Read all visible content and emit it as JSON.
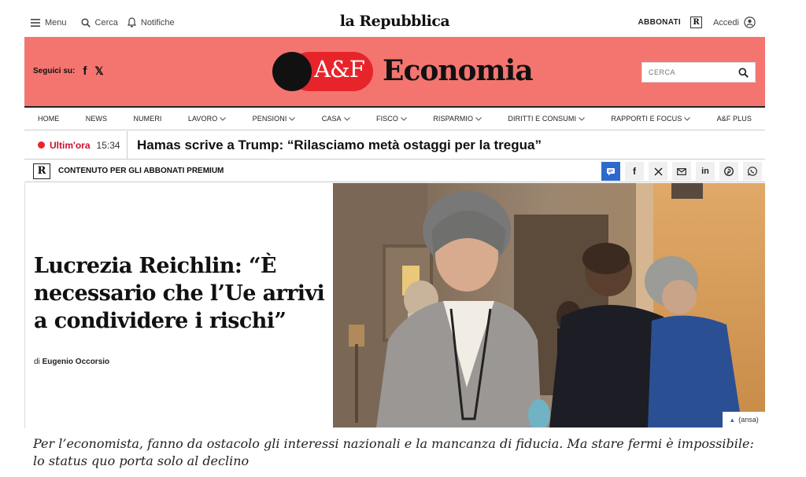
{
  "topbar": {
    "menu_label": "Menu",
    "search_label": "Cerca",
    "notifications_label": "Notifiche",
    "logo": "la Repubblica",
    "subscribe_label": "ABBONATI",
    "r_badge": "R",
    "login_label": "Accedi"
  },
  "section_header": {
    "follow_label": "Seguici su:",
    "facebook_glyph": "f",
    "x_glyph": "𝕏",
    "af_logo_text": "A&F",
    "section_title": "Economia",
    "search_placeholder": "CERCA",
    "brand_color": "#f4756f",
    "accent_color": "#e8242b"
  },
  "nav": {
    "items": [
      {
        "label": "HOME",
        "dropdown": false
      },
      {
        "label": "NEWS",
        "dropdown": false
      },
      {
        "label": "NUMERI",
        "dropdown": false
      },
      {
        "label": "LAVORO",
        "dropdown": true
      },
      {
        "label": "PENSIONI",
        "dropdown": true
      },
      {
        "label": "CASA",
        "dropdown": true
      },
      {
        "label": "FISCO",
        "dropdown": true
      },
      {
        "label": "RISPARMIO",
        "dropdown": true
      },
      {
        "label": "DIRITTI E CONSUMI",
        "dropdown": true
      },
      {
        "label": "RAPPORTI E FOCUS",
        "dropdown": true
      },
      {
        "label": "A&F PLUS",
        "dropdown": false
      }
    ]
  },
  "breaking": {
    "label": "Ultim'ora",
    "time": "15:34",
    "headline": "Hamas scrive a Trump: “Rilasciamo metà ostaggi per la tregua”"
  },
  "premium": {
    "badge": "R",
    "label": "CONTENUTO PER GLI ABBONATI PREMIUM",
    "share_icons": [
      "comment-icon",
      "facebook-icon",
      "x-icon",
      "mail-icon",
      "linkedin-icon",
      "pinterest-icon",
      "whatsapp-icon"
    ]
  },
  "article": {
    "headline": "Lucrezia Reichlin: “È necessario che l’Ue arrivi a condividere i rischi”",
    "byline_prefix": "di",
    "author": "Eugenio Occorsio",
    "photo_credit": "(ansa)",
    "subtitle": "Per l’economista, fanno da ostacolo gli interessi nazionali e la mancanza di fiducia. Ma stare fermi è impossibile: lo status quo porta solo al declino"
  }
}
